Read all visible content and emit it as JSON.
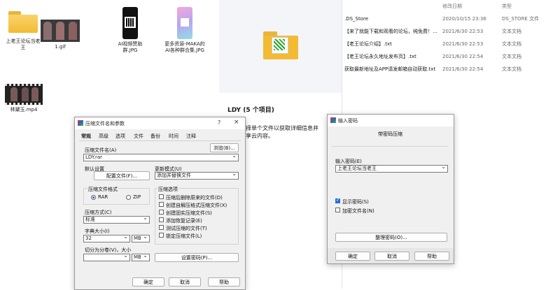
{
  "desktop_items": [
    {
      "label": "上老王论坛当老王",
      "kind": "folder"
    },
    {
      "label": "1.gif",
      "kind": "image-strip"
    },
    {
      "label": "AI视频赞助群.JPG",
      "kind": "phone-qr"
    },
    {
      "label": "更多资源-MAKA的AI各种群合集.JPG",
      "kind": "phone-gradient"
    },
    {
      "label": "林黛玉.mp4",
      "kind": "video"
    }
  ],
  "details_pane": {
    "title": "LDY (5 个项目)",
    "hint_line1": "选择单个文件以获取详细信息并",
    "hint_line2": "共享云内容。"
  },
  "file_list": {
    "headers": {
      "name": "",
      "date": "修改日期",
      "type": "类型"
    },
    "rows": [
      {
        "name": ".DS_Store",
        "date": "2020/10/15 23:36",
        "type": "DS_STORE 文件"
      },
      {
        "name": "【来了就能下载和观看的论坛，纯免费！...",
        "date": "2021/6/30 22:53",
        "type": "文本文档"
      },
      {
        "name": "【老王论坛介绍】.txt",
        "date": "2021/6/30 22:53",
        "type": "文本文档"
      },
      {
        "name": "【老王论坛永久地址发布页】.txt",
        "date": "2021/6/30 22:54",
        "type": "文本文档"
      },
      {
        "name": "获取最新地址及APP请发邮箱自动获取.txt",
        "date": "2021/6/30 22:54",
        "type": "文本文档"
      }
    ]
  },
  "archive_dialog": {
    "title": "压缩文件名和参数",
    "help_btn": "?",
    "close_btn": "×",
    "tabs": [
      "常规",
      "高级",
      "选项",
      "文件",
      "备份",
      "时间",
      "注释"
    ],
    "archive_name_label": "压缩文件名(A)",
    "archive_name_value": "LDY.rar",
    "browse": "浏览(B)...",
    "default_settings_label": "默认设置",
    "profiles_btn": "配置文件(F)...",
    "update_mode_label": "更新模式(U)",
    "update_mode_value": "添加并替换文件",
    "format_group": "压缩文件格式",
    "format_rar": "RAR",
    "format_zip": "ZIP",
    "method_label": "压缩方式(C)",
    "method_value": "标准",
    "dict_label": "字典大小(I)",
    "dict_value": "32",
    "dict_unit": "MB",
    "split_label": "切分为分卷(V)，大小",
    "split_unit": "MB",
    "options_group": "压缩选项",
    "options": [
      {
        "label": "压缩后删除原来的文件(D)",
        "checked": false
      },
      {
        "label": "创建自解压格式压缩文件(X)",
        "checked": false
      },
      {
        "label": "创建固实压缩文件(S)",
        "checked": false
      },
      {
        "label": "添加恢复记录(E)",
        "checked": false
      },
      {
        "label": "测试压缩的文件(T)",
        "checked": false
      },
      {
        "label": "锁定压缩文件(L)",
        "checked": false
      }
    ],
    "set_password_btn": "设置密码(P)...",
    "ok": "确定",
    "cancel": "取消",
    "help": "帮助"
  },
  "password_dialog": {
    "title": "输入密码",
    "heading": "带密码压缩",
    "password_label": "输入密码(E)",
    "password_value": "上老王论坛当老王",
    "show_password": {
      "label": "显示密码(S)",
      "checked": true
    },
    "encrypt_names": {
      "label": "加密文件名(N)",
      "checked": false
    },
    "organize_btn": "整理密码(O)...",
    "ok": "确定",
    "cancel": "取消",
    "help": "帮助"
  },
  "colors": {
    "accent": "#2a6fd6",
    "folder": "#f2bb33",
    "dialog_bg": "#f0f0f0"
  }
}
